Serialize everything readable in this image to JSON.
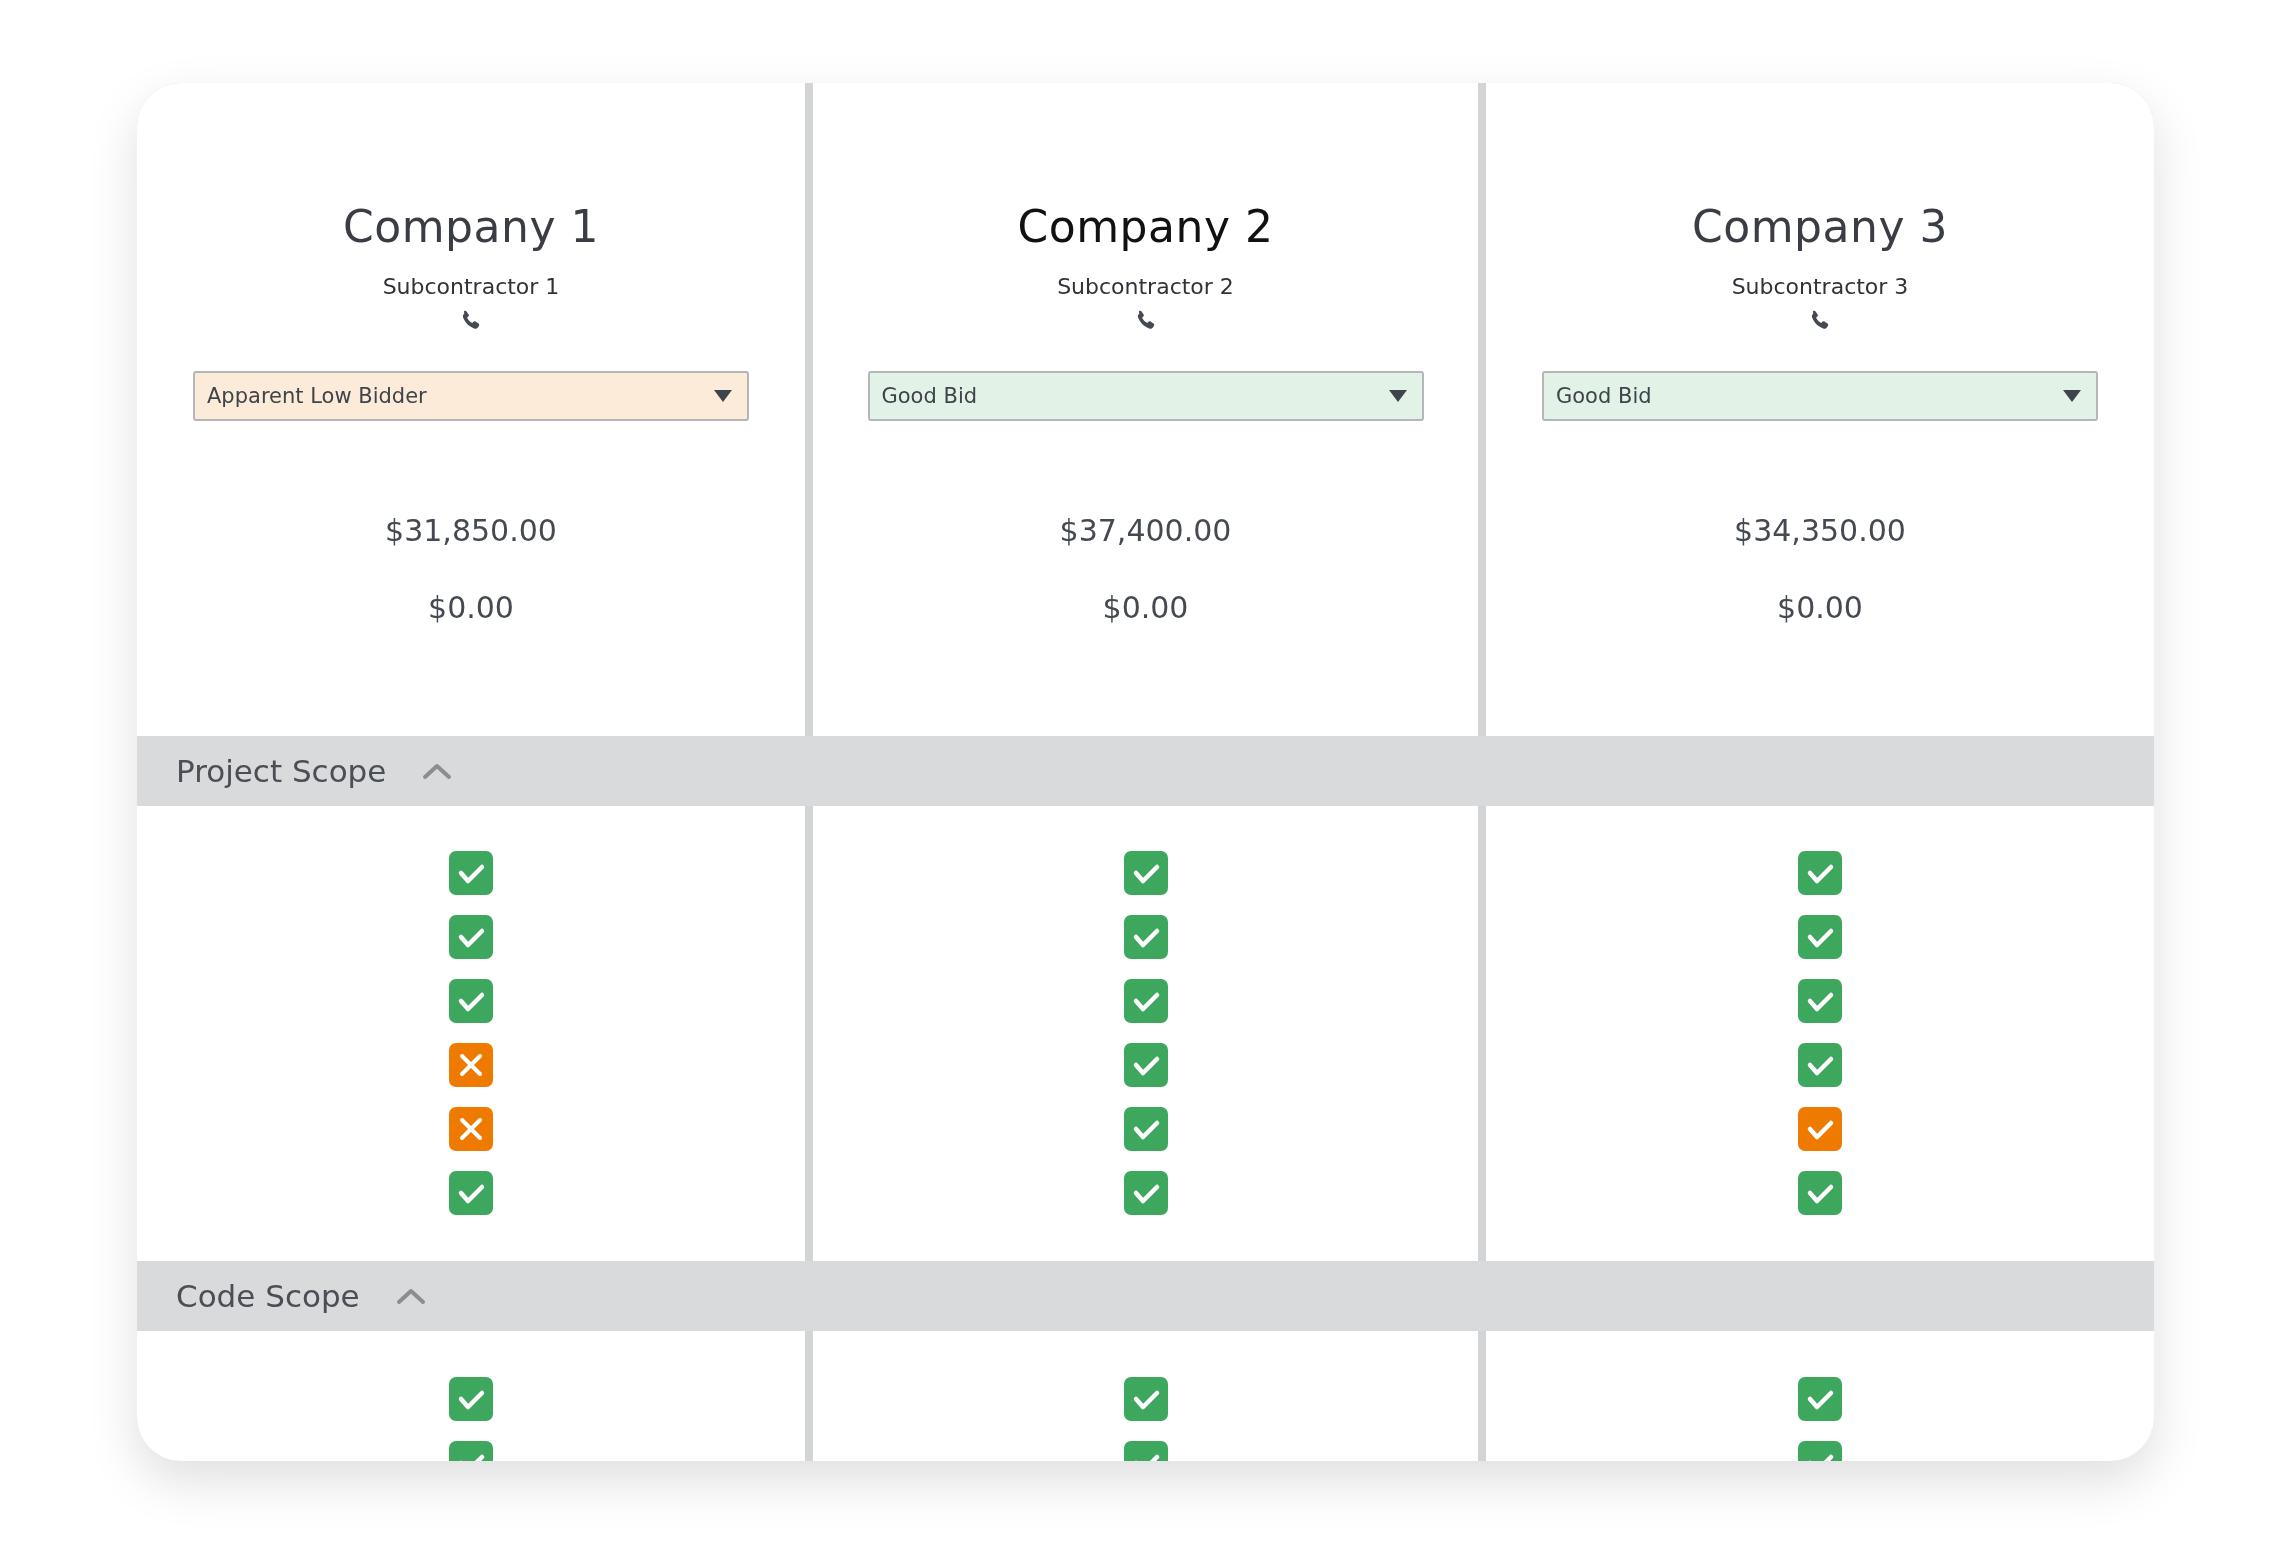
{
  "bidders": [
    {
      "company": "Company 1",
      "subcontractor": "Subcontractor 1",
      "selected": false,
      "status": {
        "label": "Apparent Low Bidder",
        "color": "#fdebd9"
      },
      "amounts": [
        "$31,850.00",
        "$0.00"
      ]
    },
    {
      "company": "Company 2",
      "subcontractor": "Subcontractor 2",
      "selected": true,
      "status": {
        "label": "Good Bid",
        "color": "#e3f2e6"
      },
      "amounts": [
        "$37,400.00",
        "$0.00"
      ]
    },
    {
      "company": "Company 3",
      "subcontractor": "Subcontractor 3",
      "selected": false,
      "status": {
        "label": "Good Bid",
        "color": "#e3f2e6"
      },
      "amounts": [
        "$34,350.00",
        "$0.00"
      ]
    }
  ],
  "sections": [
    {
      "title": "Project Scope",
      "expanded": true,
      "columns": [
        [
          {
            "kind": "check",
            "color": "#3da85d"
          },
          {
            "kind": "check",
            "color": "#3da85d"
          },
          {
            "kind": "check",
            "color": "#3da85d"
          },
          {
            "kind": "cross",
            "color": "#ee7a00"
          },
          {
            "kind": "cross",
            "color": "#ee7a00"
          },
          {
            "kind": "check",
            "color": "#3da85d"
          }
        ],
        [
          {
            "kind": "check",
            "color": "#3da85d"
          },
          {
            "kind": "check",
            "color": "#3da85d"
          },
          {
            "kind": "check",
            "color": "#3da85d"
          },
          {
            "kind": "check",
            "color": "#3da85d"
          },
          {
            "kind": "check",
            "color": "#3da85d"
          },
          {
            "kind": "check",
            "color": "#3da85d"
          }
        ],
        [
          {
            "kind": "check",
            "color": "#3da85d"
          },
          {
            "kind": "check",
            "color": "#3da85d"
          },
          {
            "kind": "check",
            "color": "#3da85d"
          },
          {
            "kind": "check",
            "color": "#3da85d"
          },
          {
            "kind": "check",
            "color": "#ee7a00"
          },
          {
            "kind": "check",
            "color": "#3da85d"
          }
        ]
      ]
    },
    {
      "title": "Code Scope",
      "expanded": true,
      "columns": [
        [
          {
            "kind": "check",
            "color": "#3da85d"
          },
          {
            "kind": "check",
            "color": "#3da85d"
          }
        ],
        [
          {
            "kind": "check",
            "color": "#3da85d"
          },
          {
            "kind": "check",
            "color": "#3da85d"
          }
        ],
        [
          {
            "kind": "check",
            "color": "#3da85d"
          },
          {
            "kind": "check",
            "color": "#3da85d"
          }
        ]
      ]
    }
  ]
}
